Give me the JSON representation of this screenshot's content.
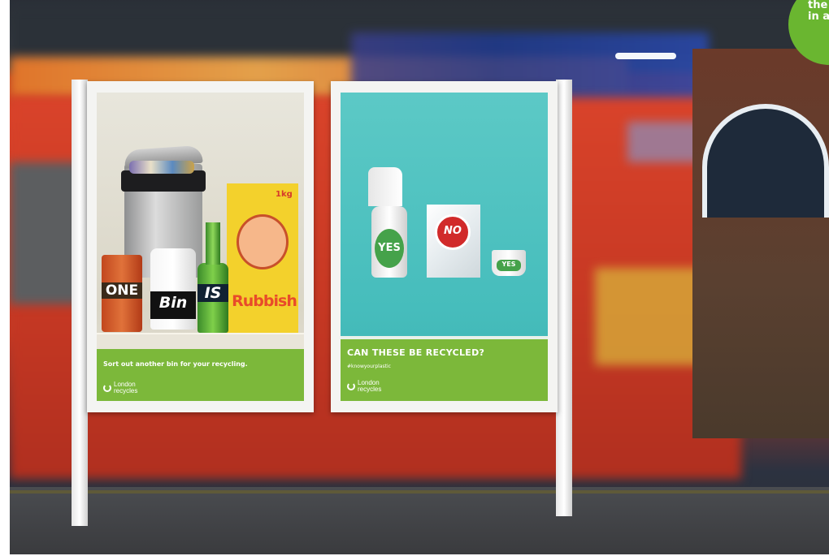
{
  "scene": {
    "description_colors": {
      "train": "#d9432a",
      "sky": "#2a2f37",
      "green": "#7cb83a",
      "teal": "#53c8c6"
    }
  },
  "poster_left": {
    "words": {
      "one": "ONE",
      "bin": "Bin",
      "is": "IS",
      "rubbish": "Rubbish",
      "weight": "1kg"
    },
    "caption": "Sort out another bin for your recycling.",
    "logo": {
      "line1": "London",
      "line2": "recycles"
    }
  },
  "poster_right": {
    "labels": {
      "yes_bottle": "YES",
      "no_bag": "NO",
      "yes_pot": "YES"
    },
    "headline": "CAN THESE BE RECYCLED?",
    "hashtag": "#knowyourplastic",
    "logo": {
      "line1": "London",
      "line2": "recycles"
    }
  },
  "corner_badge": {
    "line1": "the",
    "line2": "in a"
  }
}
